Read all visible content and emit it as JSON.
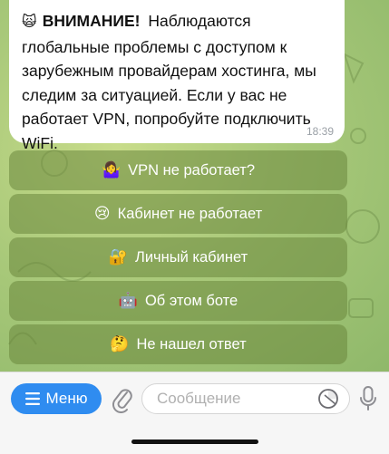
{
  "message": {
    "warn_emoji": "🙀",
    "title": "ВНИМАНИЕ!",
    "body": "Наблюдаются глобальные проблемы с доступом к зарубежным провайдерам хостинга, мы следим за ситуацией. Если у вас не работает VPN, попробуйте подключить WiFi.",
    "time": "18:39"
  },
  "keyboard": [
    {
      "emoji": "🤷‍♀️",
      "label": "VPN не работает?"
    },
    {
      "emoji": "😢",
      "label": "Кабинет не работает"
    },
    {
      "emoji": "🔐",
      "label": "Личный кабинет"
    },
    {
      "emoji": "🤖",
      "label": "Об этом боте"
    },
    {
      "emoji": "🤔",
      "label": "Не нашел ответ"
    }
  ],
  "composer": {
    "menu_label": "Меню",
    "input_placeholder": "Сообщение"
  },
  "colors": {
    "accent": "#2f8cf0",
    "keyboard_button": "#6a873c",
    "chat_background": "#a9c97a"
  }
}
